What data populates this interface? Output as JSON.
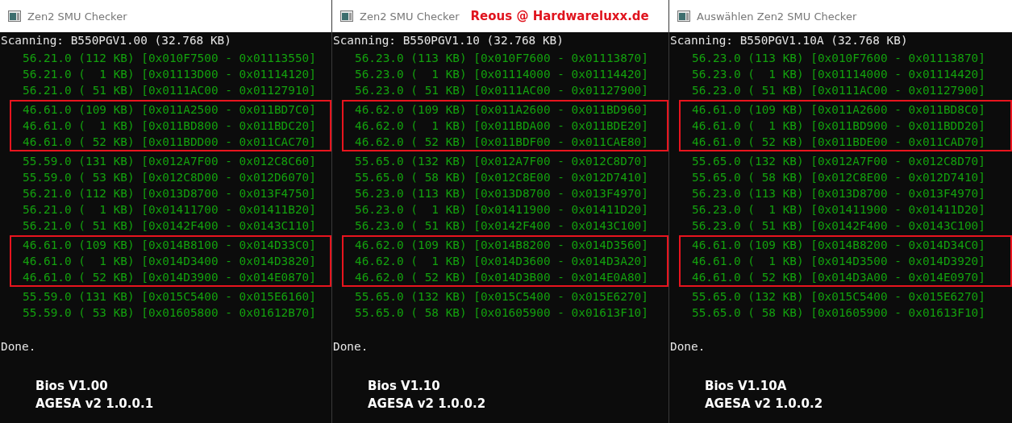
{
  "windows": [
    {
      "title": "Zen2 SMU Checker",
      "scanning": "Scanning: B550PGV1.00 (32.768 KB)",
      "blocks": [
        {
          "highlighted": false,
          "rows": [
            "56.21.0 (112 KB) [0x010F7500 - 0x01113550]",
            "56.21.0 (  1 KB) [0x01113D00 - 0x01114120]",
            "56.21.0 ( 51 KB) [0x0111AC00 - 0x01127910]"
          ]
        },
        {
          "highlighted": true,
          "rows": [
            "46.61.0 (109 KB) [0x011A2500 - 0x011BD7C0]",
            "46.61.0 (  1 KB) [0x011BD800 - 0x011BDC20]",
            "46.61.0 ( 52 KB) [0x011BDD00 - 0x011CAC70]"
          ]
        },
        {
          "highlighted": false,
          "rows": [
            "55.59.0 (131 KB) [0x012A7F00 - 0x012C8C60]",
            "55.59.0 ( 53 KB) [0x012C8D00 - 0x012D6070]",
            "56.21.0 (112 KB) [0x013D8700 - 0x013F4750]",
            "56.21.0 (  1 KB) [0x01411700 - 0x01411B20]",
            "56.21.0 ( 51 KB) [0x0142F400 - 0x0143C110]"
          ]
        },
        {
          "highlighted": true,
          "rows": [
            "46.61.0 (109 KB) [0x014B8100 - 0x014D33C0]",
            "46.61.0 (  1 KB) [0x014D3400 - 0x014D3820]",
            "46.61.0 ( 52 KB) [0x014D3900 - 0x014E0870]"
          ]
        },
        {
          "highlighted": false,
          "rows": [
            "55.59.0 (131 KB) [0x015C5400 - 0x015E6160]",
            "55.59.0 ( 53 KB) [0x01605800 - 0x01612B70]"
          ]
        }
      ],
      "done": "Done.",
      "notes": [
        "Bios V1.00",
        "AGESA v2 1.0.0.1"
      ]
    },
    {
      "title": "Zen2 SMU Checker",
      "annotation": "Reous @ Hardwareluxx.de",
      "scanning": "Scanning: B550PGV1.10 (32.768 KB)",
      "blocks": [
        {
          "highlighted": false,
          "rows": [
            "56.23.0 (113 KB) [0x010F7600 - 0x01113870]",
            "56.23.0 (  1 KB) [0x01114000 - 0x01114420]",
            "56.23.0 ( 51 KB) [0x0111AC00 - 0x01127900]"
          ]
        },
        {
          "highlighted": true,
          "rows": [
            "46.62.0 (109 KB) [0x011A2600 - 0x011BD960]",
            "46.62.0 (  1 KB) [0x011BDA00 - 0x011BDE20]",
            "46.62.0 ( 52 KB) [0x011BDF00 - 0x011CAE80]"
          ]
        },
        {
          "highlighted": false,
          "rows": [
            "55.65.0 (132 KB) [0x012A7F00 - 0x012C8D70]",
            "55.65.0 ( 58 KB) [0x012C8E00 - 0x012D7410]",
            "56.23.0 (113 KB) [0x013D8700 - 0x013F4970]",
            "56.23.0 (  1 KB) [0x01411900 - 0x01411D20]",
            "56.23.0 ( 51 KB) [0x0142F400 - 0x0143C100]"
          ]
        },
        {
          "highlighted": true,
          "rows": [
            "46.62.0 (109 KB) [0x014B8200 - 0x014D3560]",
            "46.62.0 (  1 KB) [0x014D3600 - 0x014D3A20]",
            "46.62.0 ( 52 KB) [0x014D3B00 - 0x014E0A80]"
          ]
        },
        {
          "highlighted": false,
          "rows": [
            "55.65.0 (132 KB) [0x015C5400 - 0x015E6270]",
            "55.65.0 ( 58 KB) [0x01605900 - 0x01613F10]"
          ]
        }
      ],
      "done": "Done.",
      "notes": [
        "Bios V1.10",
        "AGESA v2 1.0.0.2"
      ]
    },
    {
      "title": "Auswählen Zen2 SMU Checker",
      "scanning": "Scanning: B550PGV1.10A (32.768 KB)",
      "blocks": [
        {
          "highlighted": false,
          "rows": [
            "56.23.0 (113 KB) [0x010F7600 - 0x01113870]",
            "56.23.0 (  1 KB) [0x01114000 - 0x01114420]",
            "56.23.0 ( 51 KB) [0x0111AC00 - 0x01127900]"
          ]
        },
        {
          "highlighted": true,
          "rows": [
            "46.61.0 (109 KB) [0x011A2600 - 0x011BD8C0]",
            "46.61.0 (  1 KB) [0x011BD900 - 0x011BDD20]",
            "46.61.0 ( 52 KB) [0x011BDE00 - 0x011CAD70]"
          ]
        },
        {
          "highlighted": false,
          "rows": [
            "55.65.0 (132 KB) [0x012A7F00 - 0x012C8D70]",
            "55.65.0 ( 58 KB) [0x012C8E00 - 0x012D7410]",
            "56.23.0 (113 KB) [0x013D8700 - 0x013F4970]",
            "56.23.0 (  1 KB) [0x01411900 - 0x01411D20]",
            "56.23.0 ( 51 KB) [0x0142F400 - 0x0143C100]"
          ]
        },
        {
          "highlighted": true,
          "rows": [
            "46.61.0 (109 KB) [0x014B8200 - 0x014D34C0]",
            "46.61.0 (  1 KB) [0x014D3500 - 0x014D3920]",
            "46.61.0 ( 52 KB) [0x014D3A00 - 0x014E0970]"
          ]
        },
        {
          "highlighted": false,
          "rows": [
            "55.65.0 (132 KB) [0x015C5400 - 0x015E6270]",
            "55.65.0 ( 58 KB) [0x01605900 - 0x01613F10]"
          ]
        }
      ],
      "done": "Done.",
      "notes": [
        "Bios V1.10A",
        "AGESA v2 1.0.0.2"
      ]
    }
  ]
}
